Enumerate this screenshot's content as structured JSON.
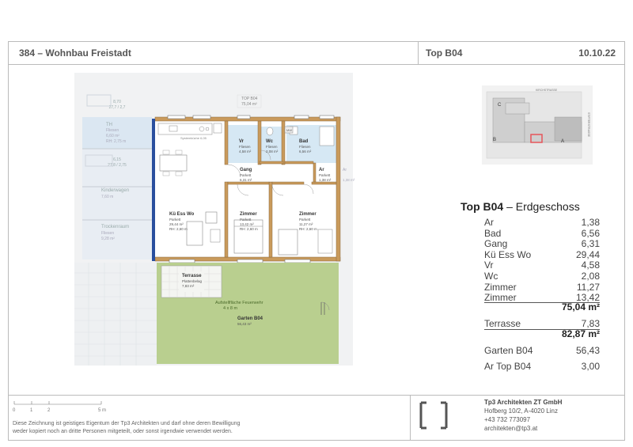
{
  "header": {
    "project": "384 – Wohnbau Freistadt",
    "unit": "Top B04",
    "date": "10.10.22"
  },
  "plan": {
    "top_label": "TOP B04",
    "top_area": "75,04 m²",
    "neighbor_labels": {
      "th": "TH",
      "th_sub": "Fliesen",
      "th_area": "6,60 m²",
      "th_rh": "RH: 2,75 m",
      "kinderwagen": "Kinderwagen",
      "kinderwagen_area": "7,60 m",
      "trockenraum": "Trockenraum",
      "trockenraum_sub": "Fliesen",
      "trockenraum_area": "9,28 m²",
      "right_ar": "Ar",
      "right_ar_area": "1,38 m²"
    },
    "kitchen_label": "Systemküche 6,05",
    "rooms": {
      "vr": {
        "name": "Vr",
        "floor": "Fliesen",
        "area": "4,58 m²"
      },
      "wc": {
        "name": "Wc",
        "floor": "Fliesen",
        "area": "2,08 m²"
      },
      "bad": {
        "name": "Bad",
        "floor": "Fliesen",
        "area": "6,56 m²"
      },
      "gang": {
        "name": "Gang",
        "floor": "Parkett",
        "area": "6,31 m²"
      },
      "ar": {
        "name": "Ar",
        "floor": "Parkett",
        "area": "1,38 m²"
      },
      "kue": {
        "name": "Kü Ess Wo",
        "floor": "Parkett",
        "area": "29,44 m²",
        "rh": "RH: 2,60 m"
      },
      "zimmer1": {
        "name": "Zimmer",
        "floor": "Parkett",
        "area": "13,42 m²",
        "rh": "RH: 2,60 m"
      },
      "zimmer2": {
        "name": "Zimmer",
        "floor": "Parkett",
        "area": "11,27 m²",
        "rh": "RH: 2,60 m"
      },
      "terrasse": {
        "name": "Terrasse",
        "floor": "Plattenbelag",
        "area": "7,83 m²"
      },
      "feuerwehr": {
        "line1": "Aufstellfläche Feuerwehr",
        "line2": "4 x 8 m"
      },
      "garten": {
        "name": "Garten B04",
        "area": "56,43 m²"
      },
      "mw": "MW"
    }
  },
  "keymap": {
    "street_top": "KIRCHSTRASSE",
    "street_right": "STIFTERSTRASSE",
    "label_c": "C",
    "label_b": "B",
    "label_a": "A"
  },
  "area_table": {
    "title_bold": "Top B04",
    "title_rest": " – Erdgeschoss",
    "rooms": [
      {
        "name": "Ar",
        "value": "1,38"
      },
      {
        "name": "Bad",
        "value": "6,56"
      },
      {
        "name": "Gang",
        "value": "6,31"
      },
      {
        "name": "Kü Ess Wo",
        "value": "29,44"
      },
      {
        "name": "Vr",
        "value": "4,58"
      },
      {
        "name": "Wc",
        "value": "2,08"
      },
      {
        "name": "Zimmer",
        "value": "11,27"
      },
      {
        "name": "Zimmer",
        "value": "13,42"
      }
    ],
    "subtotal": "75,04 m²",
    "terrasse": {
      "name": "Terrasse",
      "value": "7,83"
    },
    "total": "82,87 m²",
    "garten": {
      "name": "Garten B04",
      "value": "56,43"
    },
    "ar_top": {
      "name": "Ar Top B04",
      "value": "3,00"
    }
  },
  "footer": {
    "scale_labels": [
      "0",
      "1",
      "2",
      "5 m"
    ],
    "disclaimer_1": "Diese Zeichnung ist geistiges Eigentum der Tp3 Architekten und darf ohne deren Bewilligung",
    "disclaimer_2": "weder kopiert noch an dritte Personen mitgeteilt, oder sonst irgendwie verwendet werden.",
    "company": "Tp3 Architekten ZT GmbH",
    "address": "Hofberg 10/2, A-4020 Linz",
    "phone": "+43 732 773097",
    "email": "architekten@tp3.at"
  },
  "colors": {
    "garden": "#b9cf8f",
    "wet_room": "#d6e8f4",
    "wall": "#c99a5b",
    "facade": "#2a4f9e",
    "highlight": "#e5555a"
  }
}
